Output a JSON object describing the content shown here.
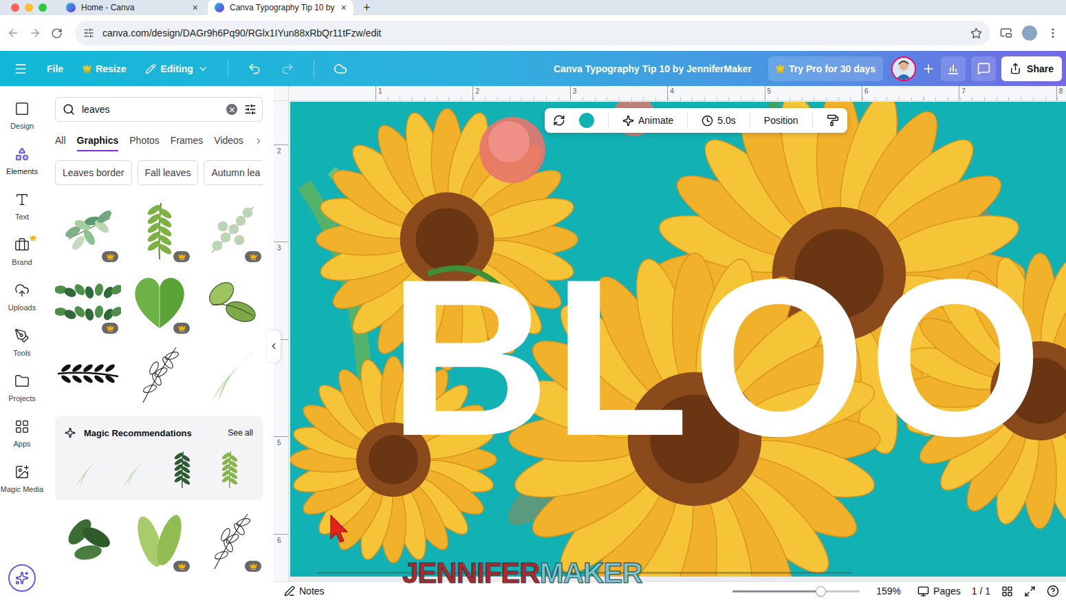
{
  "browser": {
    "tabs": [
      {
        "label": "Home - Canva",
        "close": "×",
        "selected": false
      },
      {
        "label": "Canva Typography Tip 10 by",
        "close": "×",
        "selected": true
      }
    ],
    "new_tab": "+",
    "url": "canva.com/design/DAGr9h6Pq90/RGlx1IYun88xRbQr11tFzw/edit"
  },
  "header": {
    "menu": [
      {
        "label": "File",
        "kind": "plain"
      },
      {
        "label": "Resize",
        "kind": "pro"
      },
      {
        "label": "Editing",
        "kind": "mode"
      }
    ],
    "history": {
      "undo_enabled": true,
      "redo_enabled": false
    },
    "title": "Canva Typography Tip 10 by JenniferMaker",
    "trial": "Try Pro for 30 days",
    "share": "Share"
  },
  "rail": [
    {
      "label": "Design",
      "selected": false,
      "pro": false
    },
    {
      "label": "Elements",
      "selected": true,
      "pro": false
    },
    {
      "label": "Text",
      "selected": false,
      "pro": false
    },
    {
      "label": "Brand",
      "selected": false,
      "pro": true
    },
    {
      "label": "Uploads",
      "selected": false,
      "pro": false
    },
    {
      "label": "Tools",
      "selected": false,
      "pro": false
    },
    {
      "label": "Projects",
      "selected": false,
      "pro": false
    },
    {
      "label": "Apps",
      "selected": false,
      "pro": false
    },
    {
      "label": "Magic Media",
      "selected": false,
      "pro": false
    }
  ],
  "panel": {
    "search": "leaves",
    "tabs": [
      {
        "label": "All",
        "selected": false
      },
      {
        "label": "Graphics",
        "selected": true
      },
      {
        "label": "Photos",
        "selected": false
      },
      {
        "label": "Frames",
        "selected": false
      },
      {
        "label": "Videos",
        "selected": false
      }
    ],
    "chips": [
      "Leaves border",
      "Fall leaves",
      "Autumn lea"
    ],
    "tiles": [
      {
        "kind": "bouquet",
        "pro": true
      },
      {
        "kind": "sprig",
        "pro": true
      },
      {
        "kind": "eucalyptus",
        "pro": true
      },
      {
        "kind": "border",
        "pro": true
      },
      {
        "kind": "heart",
        "pro": true
      },
      {
        "kind": "pair",
        "pro": false
      },
      {
        "kind": "laurel",
        "pro": false
      },
      {
        "kind": "outline",
        "pro": false
      },
      {
        "kind": "blade",
        "pro": false
      }
    ],
    "magic": {
      "title": "Magic Recommendations",
      "link": "See all",
      "tiles": [
        {
          "kind": "blade"
        },
        {
          "kind": "blade"
        },
        {
          "kind": "fern-dark"
        },
        {
          "kind": "fern"
        }
      ]
    },
    "more": [
      {
        "kind": "rubber",
        "pro": false
      },
      {
        "kind": "wide",
        "pro": true
      },
      {
        "kind": "outline",
        "pro": true
      }
    ]
  },
  "toolbar": {
    "color": "#12b2b4",
    "animate": "Animate",
    "duration": "5.0s",
    "position": "Position"
  },
  "rulers": {
    "top": [
      "1",
      "2",
      "3",
      "4",
      "5",
      "6",
      "7",
      "8"
    ],
    "left": [
      "2",
      "3",
      "5",
      "6"
    ]
  },
  "canvas": {
    "text": "BLOO",
    "watermark": [
      {
        "text": "JENNIFER",
        "color": "#b3262d"
      },
      {
        "text": "MAKER",
        "color": "#74c6d0"
      }
    ]
  },
  "footer": {
    "notes": "Notes",
    "zoom_level": 0.69,
    "zoom": "159%",
    "pages": "Pages",
    "page_count": "1 / 1"
  }
}
